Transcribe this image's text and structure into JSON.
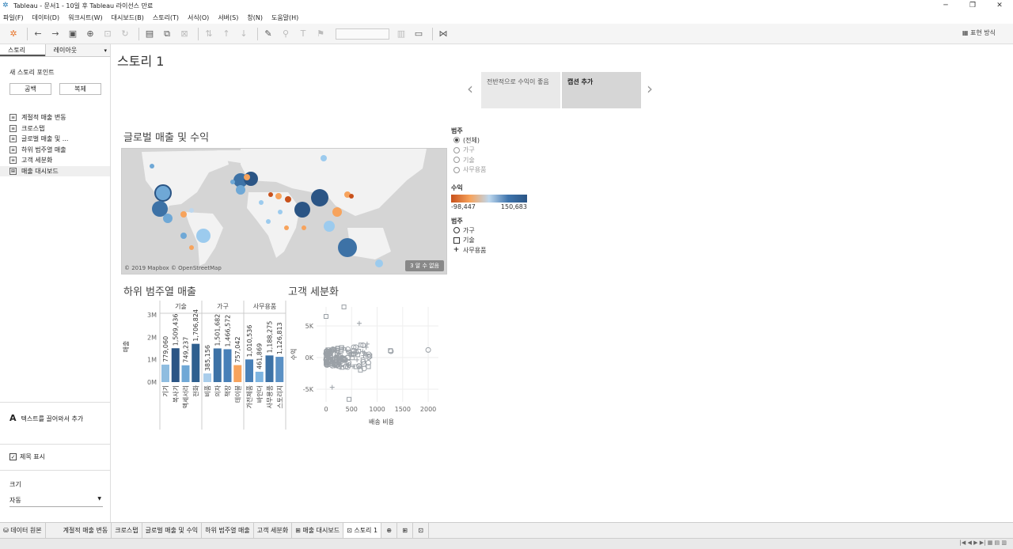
{
  "window": {
    "title": "Tableau - 문서1 - 10일 후 Tableau 라이선스 만료"
  },
  "menu": [
    "파일(F)",
    "데이터(D)",
    "워크시트(W)",
    "대시보드(B)",
    "스토리(T)",
    "서식(O)",
    "서버(S)",
    "창(N)",
    "도움말(H)"
  ],
  "toolbar": {
    "show_me": "표현 방식"
  },
  "left_pane": {
    "tabs": [
      "스토리",
      "레이아웃"
    ],
    "new_story_point": "새 스토리 포인트",
    "blank_button": "공백",
    "duplicate_button": "복제",
    "sheets": [
      "계절적 매출 변동",
      "크로스탭",
      "글로벌 매출 및 ...",
      "하위 범주열 매출",
      "고객 세분화",
      "매출 대시보드"
    ],
    "drag_text": "텍스트를 끌어와서 추가",
    "show_title": "제목 표시",
    "size_label": "크기",
    "size_value": "자동"
  },
  "story": {
    "title": "스토리 1",
    "points": [
      "전반적으로 수익이 좋음",
      "캡션 추가"
    ]
  },
  "map": {
    "title": "글로벌 매출 및 수익",
    "credit": "© 2019 Mapbox © OpenStreetMap",
    "unknown": "3 알 수 없음"
  },
  "legend": {
    "category_title": "범주",
    "options": [
      "(전체)",
      "가구",
      "기술",
      "사무용품"
    ],
    "profit_title": "수익",
    "profit_min": "-98,447",
    "profit_max": "150,683",
    "shape_title": "범주",
    "shapes": [
      "가구",
      "기술",
      "사무용품"
    ]
  },
  "bar_chart_title": "하위 범주열 매출",
  "scatter_title": "고객 세분화",
  "chart_data": [
    {
      "type": "bar",
      "ylabel": "매출",
      "ylim": [
        0,
        3000000
      ],
      "yticks": [
        "3M",
        "2M",
        "1M",
        "0M"
      ],
      "groups": [
        {
          "name": "기술",
          "categories": [
            "기기",
            "복사기",
            "액세서리",
            "전화"
          ],
          "values": [
            779060,
            1509436,
            749237,
            1706824
          ],
          "colors": [
            "#8fbde0",
            "#2b5585",
            "#6fa8d6",
            "#2e5f8f"
          ]
        },
        {
          "name": "가구",
          "categories": [
            "비품",
            "의자",
            "책장",
            "테이블"
          ],
          "values": [
            385156,
            1501682,
            1466572,
            757042
          ],
          "colors": [
            "#a9cdeb",
            "#3d72a6",
            "#4880b8",
            "#f7a35c"
          ]
        },
        {
          "name": "사무용품",
          "categories": [
            "가전제품",
            "바인더",
            "사무용품",
            "스토리지"
          ],
          "values": [
            1010536,
            461869,
            1188275,
            1126813
          ],
          "colors": [
            "#4880b8",
            "#7db4e0",
            "#3d72a6",
            "#5a90c4"
          ]
        }
      ],
      "labels": [
        "779,060",
        "1,509,436",
        "749,237",
        "1,706,824",
        "385,156",
        "1,501,682",
        "1,466,572",
        "757,042",
        "1,010,536",
        "461,869",
        "1,188,275",
        "1,126,813"
      ]
    },
    {
      "type": "scatter",
      "xlabel": "배송 비용",
      "ylabel": "수익",
      "xticks": [
        "0",
        "500",
        "1000",
        "1500",
        "2000"
      ],
      "yticks": [
        "5K",
        "0K",
        "-5K"
      ],
      "xlim": [
        0,
        2200
      ],
      "ylim": [
        -7000,
        8000
      ]
    }
  ],
  "bottom_tabs": [
    "데이터 원본",
    "계절적 매출 변동",
    "크로스탭",
    "글로벌 매출 및 수익",
    "하위 범주열 매출",
    "고객 세분화",
    "매출 대시보드",
    "스토리 1"
  ]
}
